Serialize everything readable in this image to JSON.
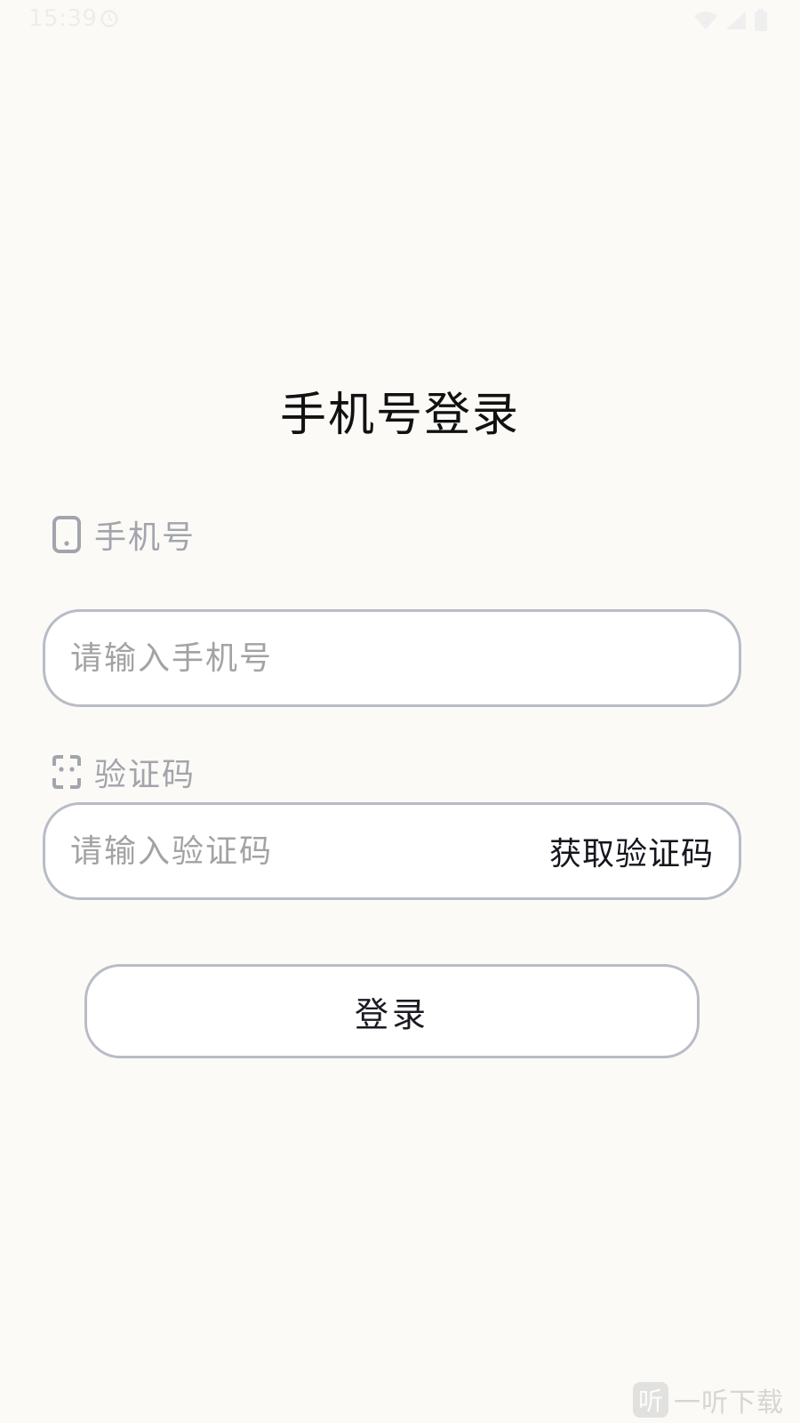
{
  "status_bar": {
    "time": "15:39"
  },
  "page": {
    "title": "手机号登录"
  },
  "phone_field": {
    "label": "手机号",
    "placeholder": "请输入手机号",
    "value": ""
  },
  "code_field": {
    "label": "验证码",
    "placeholder": "请输入验证码",
    "value": "",
    "get_code_label": "获取验证码"
  },
  "login_button": {
    "label": "登录"
  },
  "watermark": {
    "logo_glyph": "听",
    "text": "一听下载"
  },
  "icons": {
    "phone_icon": "phone-icon",
    "code_icon": "scan-code-icon",
    "status_clock": "sync-clock-icon",
    "wifi": "wifi-icon",
    "signal": "signal-icon",
    "battery": "battery-icon"
  },
  "colors": {
    "background": "#fbfaf6",
    "border": "#b8bcc6",
    "label_gray": "#a3a5ad",
    "title": "#111111"
  }
}
